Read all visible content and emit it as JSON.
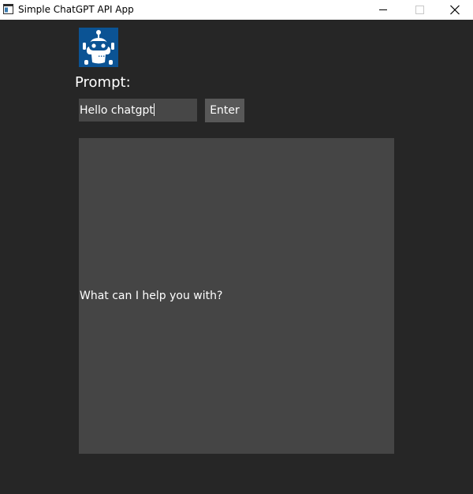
{
  "window": {
    "title": "Simple ChatGPT API App",
    "icons": {
      "app": "app-window-icon",
      "minimize": "minimize-icon",
      "maximize": "maximize-icon",
      "close": "close-icon"
    }
  },
  "main": {
    "logo": "robot-icon",
    "prompt_label": "Prompt:",
    "input_value": "Hello chatgpt",
    "enter_label": "Enter",
    "response_text": "What can I help you with?"
  },
  "colors": {
    "background": "#262626",
    "input_bg": "#474747",
    "button_bg": "#585858",
    "response_bg": "#454545",
    "logo_bg": "#0b5394",
    "text": "#ffffff"
  }
}
